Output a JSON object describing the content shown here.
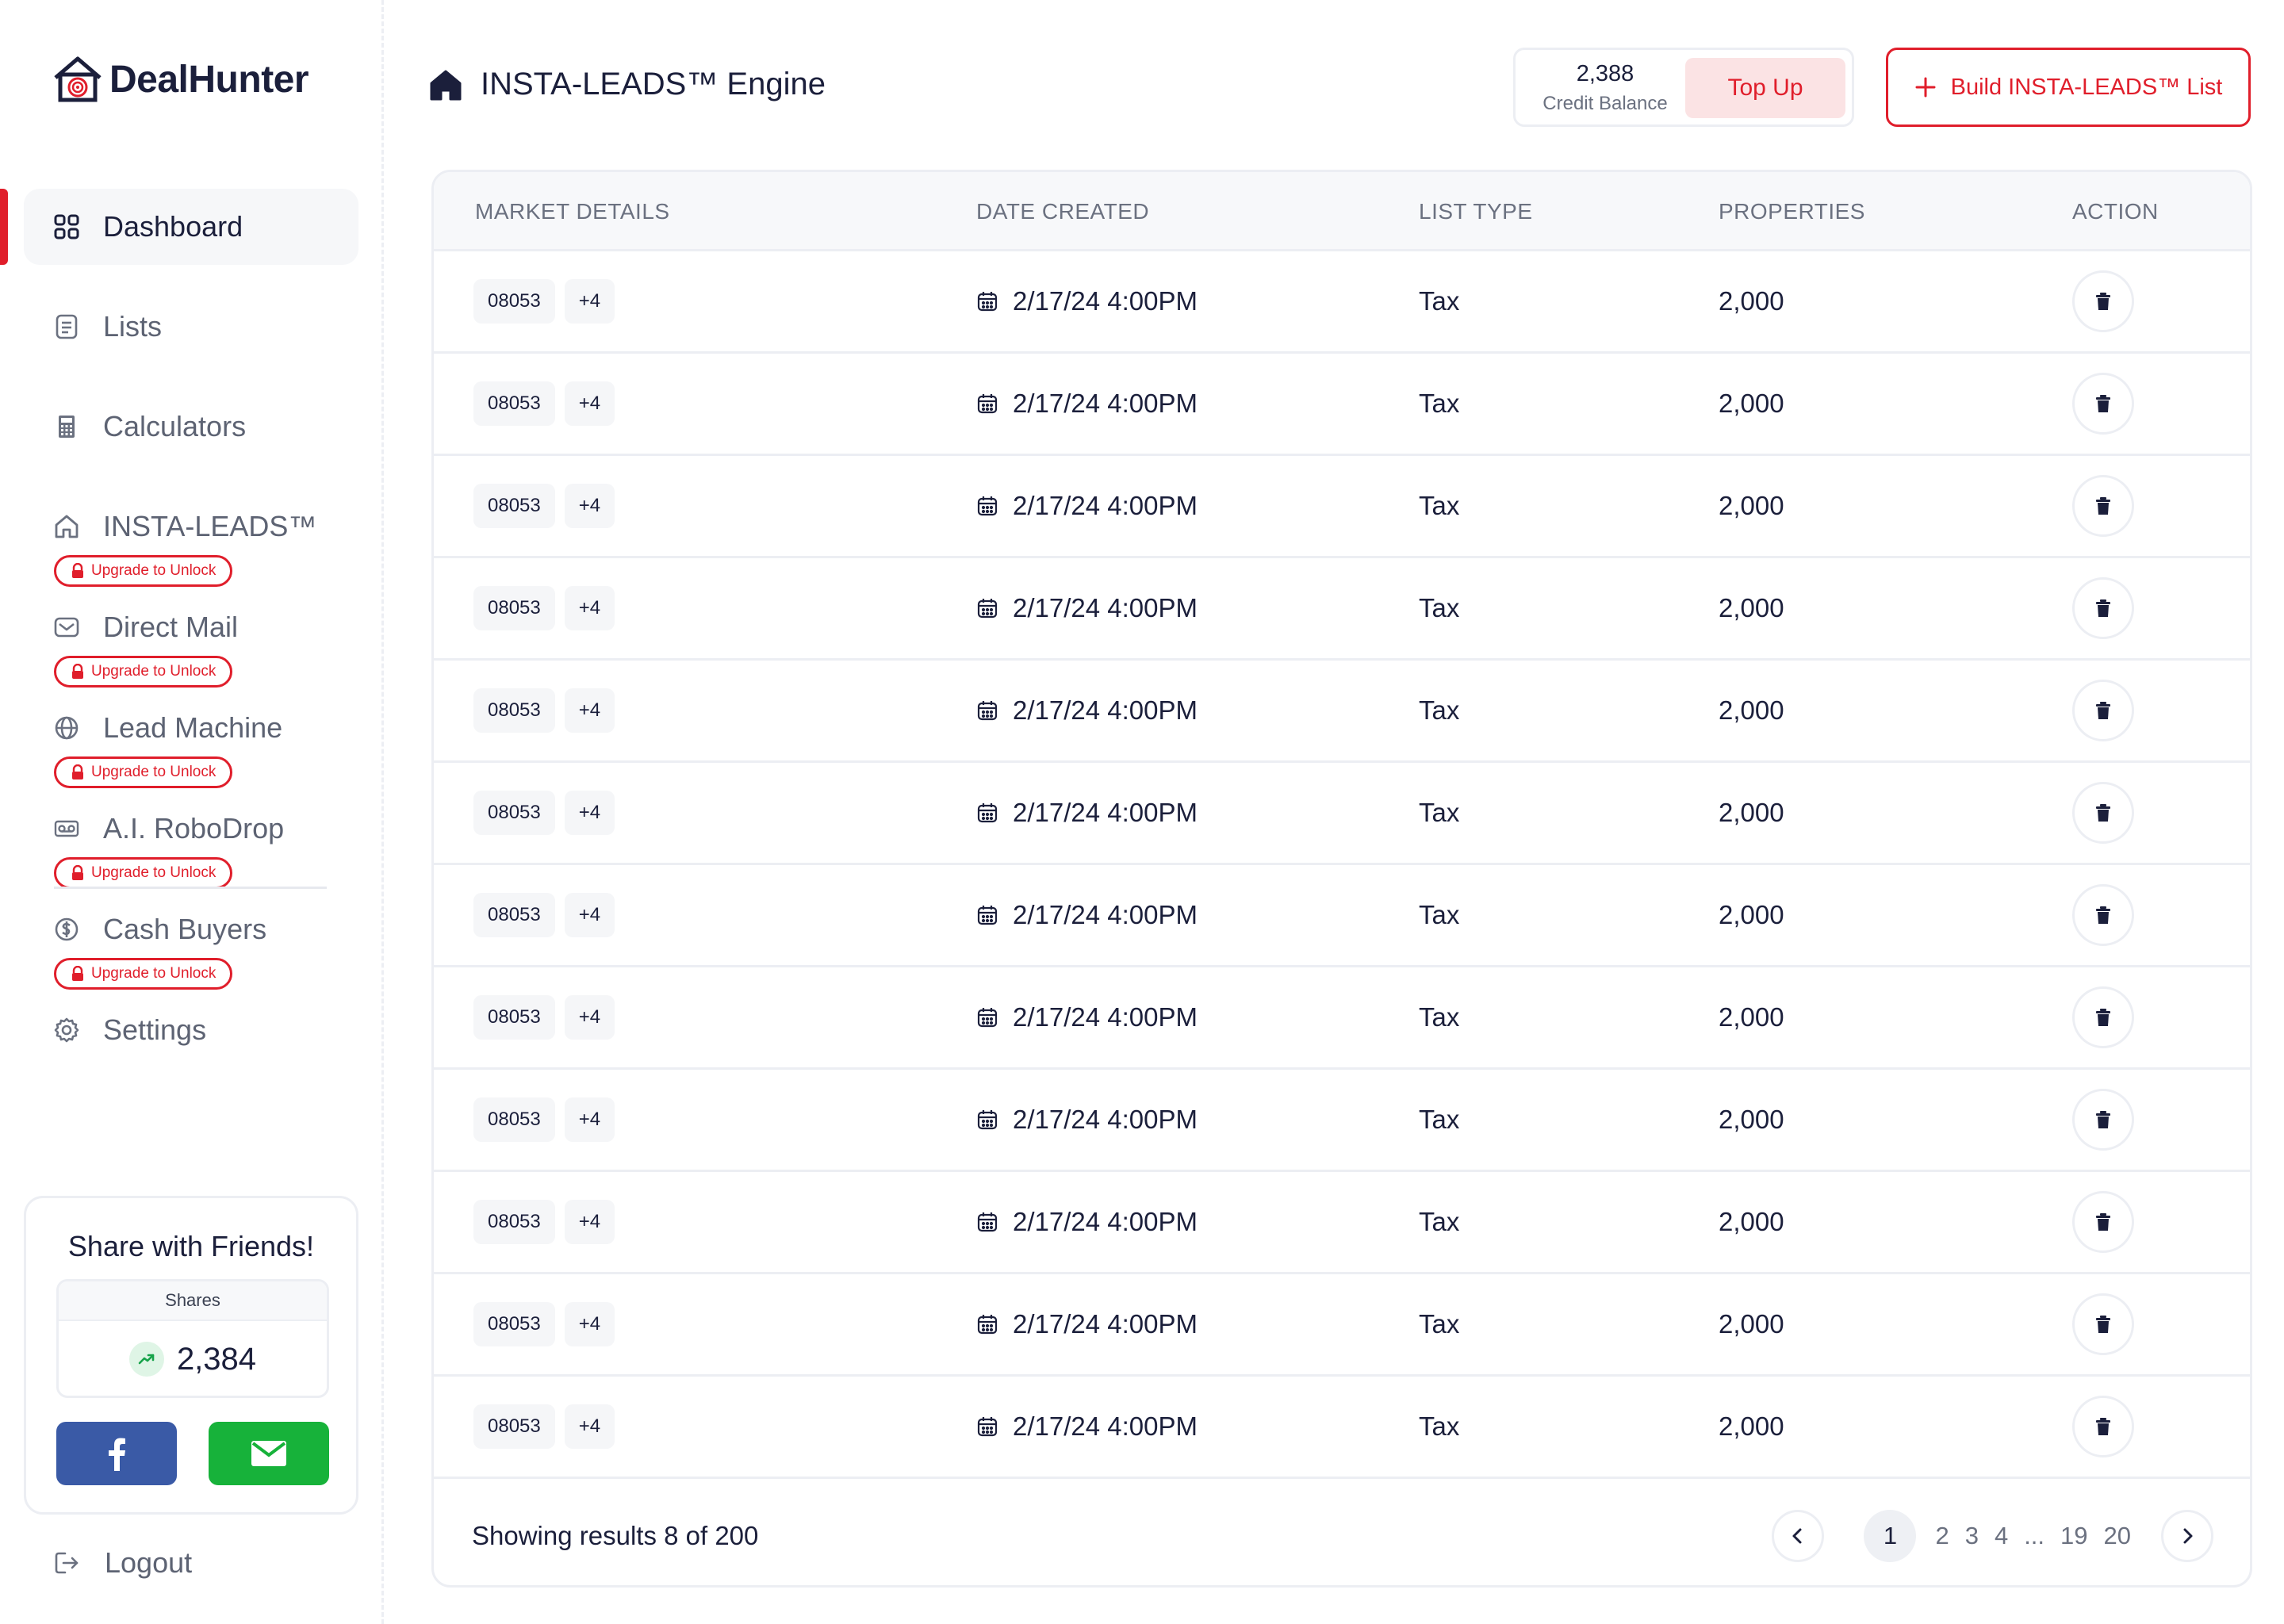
{
  "brand": {
    "name": "DealHunter"
  },
  "sidebar": {
    "items": [
      {
        "label": "Dashboard",
        "icon": "grid-icon",
        "active": true
      },
      {
        "label": "Lists",
        "icon": "list-icon"
      },
      {
        "label": "Calculators",
        "icon": "calculator-icon"
      },
      {
        "label": "INSTA-LEADS™",
        "icon": "home-icon",
        "badge": "Upgrade to Unlock"
      },
      {
        "label": "Direct Mail",
        "icon": "mail-icon",
        "badge": "Upgrade to Unlock"
      },
      {
        "label": "Lead Machine",
        "icon": "globe-icon",
        "badge": "Upgrade to Unlock"
      },
      {
        "label": "A.I. RoboDrop",
        "icon": "voicemail-icon",
        "badge": "Upgrade to Unlock"
      },
      {
        "label": "Cash Buyers",
        "icon": "dollar-circle-icon",
        "badge": "Upgrade to Unlock"
      },
      {
        "label": "Settings",
        "icon": "gear-icon"
      }
    ],
    "logout_label": "Logout"
  },
  "share": {
    "title": "Share with Friends!",
    "shares_label": "Shares",
    "shares_count": "2,384"
  },
  "header": {
    "title": "INSTA-LEADS™ Engine",
    "credit_value": "2,388",
    "credit_label": "Credit Balance",
    "topup_label": "Top Up",
    "build_label": "Build INSTA-LEADS™ List"
  },
  "table": {
    "columns": [
      "MARKET DETAILS",
      "DATE CREATED",
      "LIST TYPE",
      "PROPERTIES",
      "ACTION"
    ],
    "rows": [
      {
        "zip": "08053",
        "more": "+4",
        "date": "2/17/24 4:00PM",
        "type": "Tax",
        "properties": "2,000"
      },
      {
        "zip": "08053",
        "more": "+4",
        "date": "2/17/24 4:00PM",
        "type": "Tax",
        "properties": "2,000"
      },
      {
        "zip": "08053",
        "more": "+4",
        "date": "2/17/24 4:00PM",
        "type": "Tax",
        "properties": "2,000"
      },
      {
        "zip": "08053",
        "more": "+4",
        "date": "2/17/24 4:00PM",
        "type": "Tax",
        "properties": "2,000"
      },
      {
        "zip": "08053",
        "more": "+4",
        "date": "2/17/24 4:00PM",
        "type": "Tax",
        "properties": "2,000"
      },
      {
        "zip": "08053",
        "more": "+4",
        "date": "2/17/24 4:00PM",
        "type": "Tax",
        "properties": "2,000"
      },
      {
        "zip": "08053",
        "more": "+4",
        "date": "2/17/24 4:00PM",
        "type": "Tax",
        "properties": "2,000"
      },
      {
        "zip": "08053",
        "more": "+4",
        "date": "2/17/24 4:00PM",
        "type": "Tax",
        "properties": "2,000"
      },
      {
        "zip": "08053",
        "more": "+4",
        "date": "2/17/24 4:00PM",
        "type": "Tax",
        "properties": "2,000"
      },
      {
        "zip": "08053",
        "more": "+4",
        "date": "2/17/24 4:00PM",
        "type": "Tax",
        "properties": "2,000"
      },
      {
        "zip": "08053",
        "more": "+4",
        "date": "2/17/24 4:00PM",
        "type": "Tax",
        "properties": "2,000"
      },
      {
        "zip": "08053",
        "more": "+4",
        "date": "2/17/24 4:00PM",
        "type": "Tax",
        "properties": "2,000"
      }
    ],
    "footer_text": "Showing results 8 of 200"
  },
  "pagination": {
    "pages": [
      "1",
      "2",
      "3",
      "4",
      "...",
      "19",
      "20"
    ],
    "current": "1"
  },
  "colors": {
    "accent": "#e01e2b",
    "text": "#1b1f3b",
    "muted": "#6b7180",
    "facebook": "#3a5aa6",
    "mail": "#17b23a"
  }
}
